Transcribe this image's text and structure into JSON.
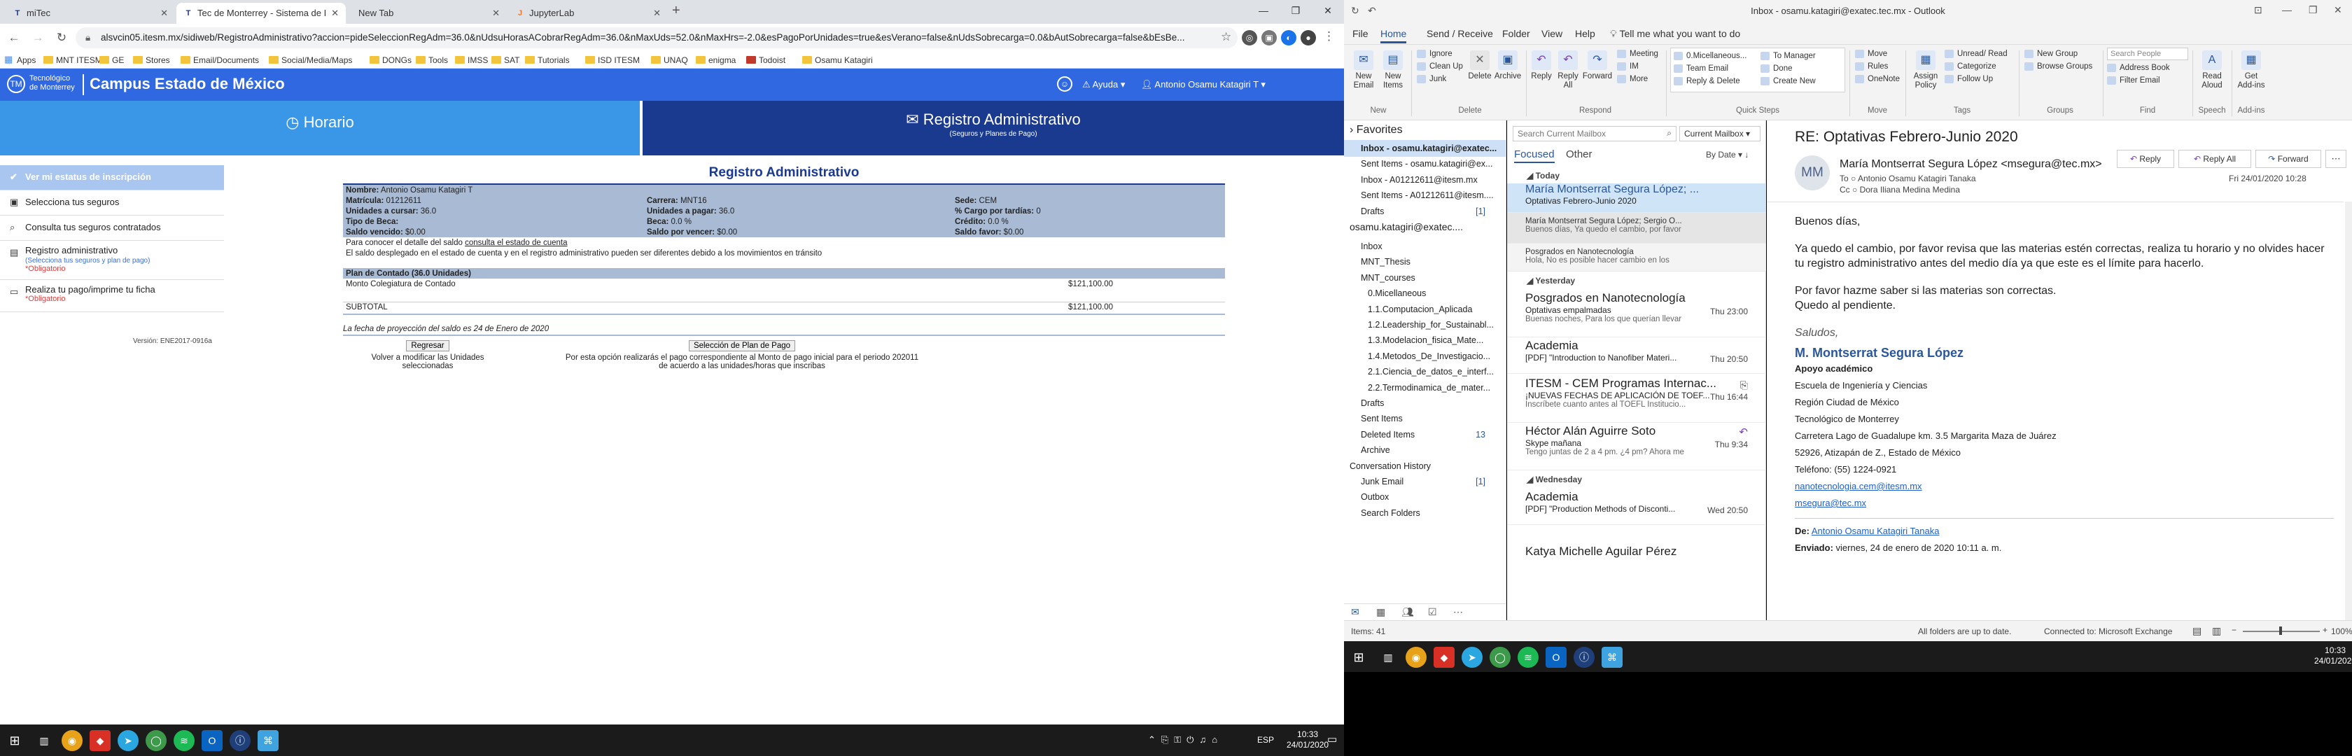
{
  "chrome": {
    "tabs": [
      {
        "favicon": "T",
        "title": "miTec"
      },
      {
        "favicon": "T",
        "title": "Tec de Monterrey - Sistema de I"
      },
      {
        "favicon": "",
        "title": "New Tab"
      },
      {
        "favicon": "J",
        "title": "JupyterLab"
      }
    ],
    "new_tab": "+",
    "url": "alsvcin05.itesm.mx/sidiweb/RegistroAdministrativo?accion=pideSeleccionRegAdm=36.0&nUdsuHorasACobrarRegAdm=36.0&nMaxUds=52.0&nMaxHrs=-2.0&esPagoPorUnidades=true&esVerano=false&nUdsSobrecarga=0.0&bAutSobrecarga=false&bEsBe...",
    "bookmarks": [
      "Apps",
      "MNT ITESM",
      "GE",
      "Stores",
      "Email/Documents",
      "Social/Media/Maps",
      "DONGs",
      "Tools",
      "IMSS",
      "SAT",
      "Tutorials",
      "ISD ITESM",
      "UNAQ",
      "enigma",
      "Todoist",
      "Osamu Katagiri"
    ]
  },
  "tec": {
    "logo_line1": "Tecnológico",
    "logo_line2": "de Monterrey",
    "campus": "Campus Estado de México",
    "help": "Ayuda",
    "user": "Antonio Osamu Katagiri T",
    "tab_horario": "Horario",
    "tab_registro": "Registro Administrativo",
    "tab_registro_sub": "(Seguros y Planes de Pago)",
    "sidebar": [
      {
        "label": "Ver mi estatus de inscripción",
        "sub": "",
        "req": ""
      },
      {
        "label": "Selecciona tus seguros",
        "sub": "",
        "req": ""
      },
      {
        "label": "Consulta tus seguros contratados",
        "sub": "",
        "req": ""
      },
      {
        "label": "Registro administrativo",
        "sub": "(Selecciona tus seguros y plan de pago)",
        "req": "*Obligatorio"
      },
      {
        "label": "Realiza tu pago/imprime tu ficha",
        "sub": "",
        "req": "*Obligatorio"
      }
    ],
    "reg": {
      "title": "Registro Administrativo",
      "nombre_l": "Nombre:",
      "nombre_v": "Antonio Osamu Katagiri T",
      "matricula_l": "Matrícula:",
      "matricula_v": "01212611",
      "carrera_l": "Carrera:",
      "carrera_v": "MNT16",
      "sede_l": "Sede:",
      "sede_v": "CEM",
      "ucursar_l": "Unidades a cursar:",
      "ucursar_v": "36.0",
      "upagar_l": "Unidades a pagar:",
      "upagar_v": "36.0",
      "cargo_l": "% Cargo por tardías:",
      "cargo_v": "0",
      "tipo_l": "Tipo de Beca:",
      "tipo_v": "",
      "beca_l": "Beca:",
      "beca_v": "0.0 %",
      "credito_l": "Crédito:",
      "credito_v": "0.0 %",
      "vencido_l": "Saldo vencido:",
      "vencido_v": "$0.00",
      "porvencer_l": "Saldo por vencer:",
      "porvencer_v": "$0.00",
      "favor_l": "Saldo favor:",
      "favor_v": "$0.00",
      "detalle_pre": "Para conocer el detalle del saldo",
      "detalle_link": "consulta el estado de cuenta",
      "aviso": "El saldo desplegado en el estado de cuenta y en el registro administrativo pueden ser diferentes debido a los movimientos en tránsito",
      "plan_hdr": "Plan de Contado (36.0 Unidades)",
      "monto_l": "Monto Colegiatura de Contado",
      "monto_v": "$121,100.00",
      "subtotal_l": "SUBTOTAL",
      "subtotal_v": "$121,100.00",
      "fecha_proy": "La fecha de proyección del saldo es 24 de Enero de 2020",
      "btn_regresar": "Regresar",
      "btn_seleccion": "Selección de Plan de Pago",
      "volver": "Volver a modificar las Unidades seleccionadas",
      "opcion": "Por esta opción realizarás el pago correspondiente al Monto de pago inicial para el periodo 202011 de acuerdo a las unidades/horas que inscribas",
      "version": "Versión: ENE2017-0916a"
    }
  },
  "win_taskbar": {
    "time": "10:33",
    "date": "24/01/2020",
    "lang": "ESP"
  },
  "outlook": {
    "title": "Inbox - osamu.katagiri@exatec.tec.mx  -  Outlook",
    "menu": [
      "File",
      "Home",
      "Send / Receive",
      "Folder",
      "View",
      "Help"
    ],
    "tell_me": "Tell me what you want to do",
    "ribbon": {
      "new_email": "New Email",
      "new_items": "New Items",
      "ignore": "Ignore",
      "clean_up": "Clean Up",
      "junk": "Junk",
      "delete": "Delete",
      "archive": "Archive",
      "reply": "Reply",
      "reply_all": "Reply All",
      "forward": "Forward",
      "meeting": "Meeting",
      "im": "IM",
      "more": "More",
      "qs1": "0.Micellaneous...",
      "qs2": "Team Email",
      "qs3": "Reply & Delete",
      "qs4": "To Manager",
      "qs5": "Done",
      "qs6": "Create New",
      "move": "Move",
      "rules": "Rules",
      "onenote": "OneNote",
      "assign_policy": "Assign Policy",
      "unread_read": "Unread/ Read",
      "categorize": "Categorize",
      "follow_up": "Follow Up",
      "new_group": "New Group",
      "browse_groups": "Browse Groups",
      "search_people": "Search People",
      "address_book": "Address Book",
      "filter_email": "Filter Email",
      "read_aloud": "Read Aloud",
      "get_addins": "Get Add-ins",
      "g_new": "New",
      "g_delete": "Delete",
      "g_respond": "Respond",
      "g_quick": "Quick Steps",
      "g_move": "Move",
      "g_tags": "Tags",
      "g_groups": "Groups",
      "g_find": "Find",
      "g_speech": "Speech",
      "g_addins": "Add-ins"
    },
    "nav": {
      "favorites": "Favorites",
      "items": [
        {
          "label": "Inbox - osamu.katagiri@exatec...",
          "count": "",
          "indent": 1,
          "bold": true,
          "sel": true
        },
        {
          "label": "Sent Items - osamu.katagiri@ex...",
          "count": "",
          "indent": 1
        },
        {
          "label": "Inbox - A01212611@itesm.mx",
          "count": "",
          "indent": 1
        },
        {
          "label": "Sent Items - A01212611@itesm....",
          "count": "",
          "indent": 1
        },
        {
          "label": "Drafts",
          "count": "[1]",
          "indent": 1
        },
        {
          "label": "osamu.katagiri@exatec....",
          "count": "",
          "indent": 0,
          "big": true
        },
        {
          "label": "Inbox",
          "count": "",
          "indent": 1
        },
        {
          "label": "MNT_Thesis",
          "count": "",
          "indent": 1
        },
        {
          "label": "MNT_courses",
          "count": "",
          "indent": 1
        },
        {
          "label": "0.Micellaneous",
          "count": "",
          "indent": 2
        },
        {
          "label": "1.1.Computacion_Aplicada",
          "count": "",
          "indent": 2
        },
        {
          "label": "1.2.Leadership_for_Sustainabl...",
          "count": "",
          "indent": 2
        },
        {
          "label": "1.3.Modelacion_fisica_Mate...",
          "count": "",
          "indent": 2
        },
        {
          "label": "1.4.Metodos_De_Investigacio...",
          "count": "",
          "indent": 2
        },
        {
          "label": "2.1.Ciencia_de_datos_e_interf...",
          "count": "",
          "indent": 2
        },
        {
          "label": "2.2.Termodinamica_de_mater...",
          "count": "",
          "indent": 2
        },
        {
          "label": "Drafts",
          "count": "",
          "indent": 1
        },
        {
          "label": "Sent Items",
          "count": "",
          "indent": 1
        },
        {
          "label": "Deleted Items",
          "count": "13",
          "indent": 1
        },
        {
          "label": "Archive",
          "count": "",
          "indent": 1
        },
        {
          "label": "Conversation History",
          "count": "",
          "indent": 0
        },
        {
          "label": "Junk Email",
          "count": "[1]",
          "indent": 1
        },
        {
          "label": "Outbox",
          "count": "",
          "indent": 1
        },
        {
          "label": "Search Folders",
          "count": "",
          "indent": 1
        }
      ]
    },
    "search_placeholder": "Search Current Mailbox",
    "scope": "Current Mailbox",
    "focused": "Focused",
    "other": "Other",
    "sort": "By Date",
    "groups": [
      "Today",
      "Yesterday",
      "Wednesday"
    ],
    "messages": [
      {
        "from": "María Montserrat Segura López;  ...",
        "subject": "Optativas Febrero-Junio 2020",
        "preview": "",
        "time": ""
      },
      {
        "from": "María Montserrat Segura López;  Sergio O...",
        "subject": "",
        "preview": "Buenos días,  Ya quedo el cambio, por favor",
        "time": ""
      },
      {
        "from": "Posgrados en Nanotecnología",
        "subject": "",
        "preview": "Hola,  No es posible hacer cambio en los",
        "time": ""
      },
      {
        "from": "Posgrados en Nanotecnología",
        "subject": "Optativas empalmadas",
        "preview": "Buenas noches,  Para los que querían llevar",
        "time": "Thu 23:00"
      },
      {
        "from": "Academia",
        "subject": "[PDF] \"Introduction to Nanofiber Materi...",
        "preview": "",
        "time": "Thu 20:50"
      },
      {
        "from": "ITESM - CEM Programas Internac...",
        "subject": "¡NUEVAS FECHAS DE APLICACIÓN DE TOEF...",
        "preview": "Inscríbete cuanto antes al TOEFL Institucio...",
        "time": "Thu 16:44"
      },
      {
        "from": "Héctor Alán Aguirre Soto",
        "subject": "Skype mañana",
        "preview": "Tengo juntas de 2 a 4 pm. ¿4 pm? Ahora me",
        "time": "Thu 9:34"
      },
      {
        "from": "Academia",
        "subject": "[PDF] \"Production Methods of Disconti...",
        "preview": "",
        "time": "Wed 20:50"
      },
      {
        "from": "Katya Michelle Aguilar Pérez",
        "subject": "",
        "preview": "",
        "time": ""
      }
    ],
    "read": {
      "subject": "RE: Optativas Febrero-Junio 2020",
      "initials": "MM",
      "from": "María Montserrat Segura López <msegura@tec.mx>",
      "to_l": "To",
      "to": "Antonio Osamu Katagiri Tanaka",
      "cc_l": "Cc",
      "cc": "Dora Iliana Medina Medina",
      "date": "Fri 24/01/2020 10:28",
      "btn_reply": "Reply",
      "btn_reply_all": "Reply All",
      "btn_forward": "Forward",
      "p1": "Buenos días,",
      "p2": "Ya quedo el cambio, por favor revisa que las materias estén correctas, realiza tu horario y no olvides hacer tu registro administrativo antes del medio día ya que este es el límite para hacerlo.",
      "p3": "Por favor hazme saber si las materias son correctas.",
      "p4": "Quedo al pendiente.",
      "saludos": "Saludos,",
      "sig_name": "M. Montserrat Segura López",
      "sig_role": "Apoyo académico",
      "sig_l1": "Escuela de Ingeniería y Ciencias",
      "sig_l2": "Región Ciudad de México",
      "sig_l3": "Tecnológico de Monterrey",
      "sig_l4": "Carretera Lago de Guadalupe km. 3.5 Margarita Maza de Juárez",
      "sig_l5": "52926, Atizapán de Z., Estado de México",
      "sig_l6": "Teléfono: (55) 1224-0921",
      "sig_mail1": "nanotecnologia.cem@itesm.mx",
      "sig_mail2": "msegura@tec.mx",
      "de_l": "De:",
      "de_v": "Antonio Osamu Katagiri Tanaka",
      "env_l": "Enviado:",
      "env_v": "viernes, 24 de enero de 2020 10:11 a. m."
    },
    "status": {
      "items": "Items: 41",
      "sync": "All folders are up to date.",
      "conn": "Connected to: Microsoft Exchange",
      "zoom": "100%"
    }
  },
  "colors": {
    "tec_blue": "#2f68e0",
    "tec_navy": "#1a3a8f",
    "outlook_blue": "#2b579a"
  }
}
